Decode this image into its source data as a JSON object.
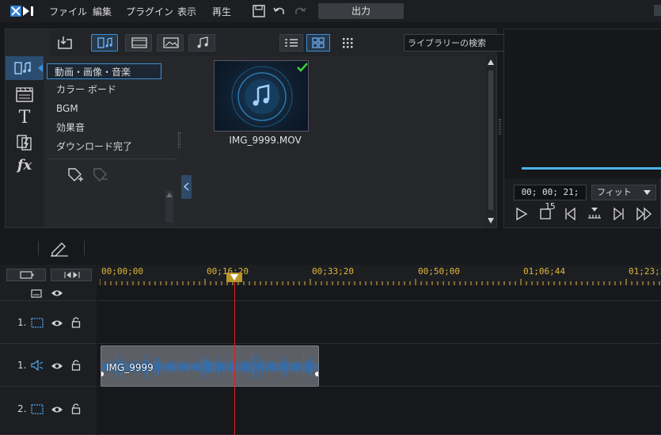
{
  "menu": {
    "items": [
      "ファイル",
      "編集",
      "プラグイン",
      "表示",
      "再生"
    ],
    "output_label": "出力"
  },
  "library": {
    "search_placeholder": "ライブラリーの検索",
    "categories": [
      "動画・画像・音楽",
      "カラー ボード",
      "BGM",
      "効果音",
      "ダウンロード完了"
    ],
    "selected_category": 0,
    "media": [
      {
        "name": "IMG_9999.MOV",
        "checked": true
      }
    ]
  },
  "preview": {
    "timecode": "00; 00; 21; 15",
    "zoom_select": "フィット"
  },
  "timeline": {
    "ruler_labels": [
      "00;00;00",
      "00;16;20",
      "00;33;20",
      "00;50;00",
      "01;06;44",
      "01;23;2"
    ],
    "tracks": [
      {
        "num": "",
        "type": "title"
      },
      {
        "num": "1.",
        "type": "video"
      },
      {
        "num": "1.",
        "type": "audio"
      },
      {
        "num": "2.",
        "type": "video"
      }
    ],
    "clip_label": "IMG_9999"
  },
  "colors": {
    "accent": "#3b8fd9",
    "ruler": "#e0b63a",
    "playhead": "#e02020",
    "check": "#3bd13b"
  }
}
